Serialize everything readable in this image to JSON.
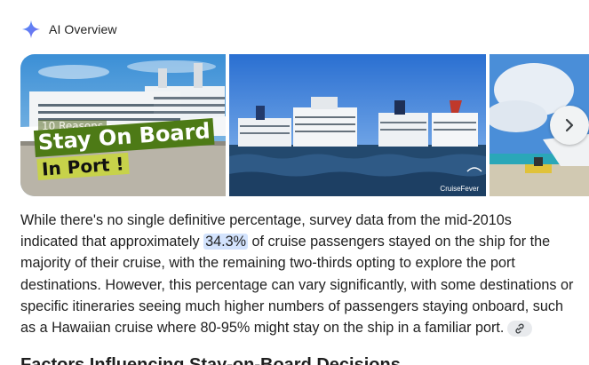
{
  "header": {
    "title": "AI Overview"
  },
  "images": [
    {
      "overlay_small": "10 Reasons",
      "overlay_big": "Stay On Board",
      "overlay_sub": "In Port !"
    },
    {
      "watermark": "CruiseFever"
    },
    {}
  ],
  "body": {
    "line1": "While there's no single definitive percentage, survey data from the mid-2010s",
    "line2_pre": "indicated that approximately ",
    "line2_highlight": "34.3%",
    "line2_post": " of cruise passengers stayed on the ship for the",
    "line3": "majority of their cruise, with the remaining two-thirds opting to explore the port",
    "line4": "destinations. However, this percentage can vary significantly, with some destinations or",
    "line5": "specific itineraries seeing much higher numbers of passengers staying onboard, such",
    "line6": "as a Hawaiian cruise where 80-95% might stay on the ship in a familiar port."
  },
  "subheading": "Factors Influencing Stay-on-Board Decisions",
  "icons": {
    "header": "sparkle-icon",
    "next": "chevron-right-icon",
    "link": "link-icon"
  },
  "colors": {
    "accent": "#4285f4",
    "highlight": "#d3e3fd"
  }
}
